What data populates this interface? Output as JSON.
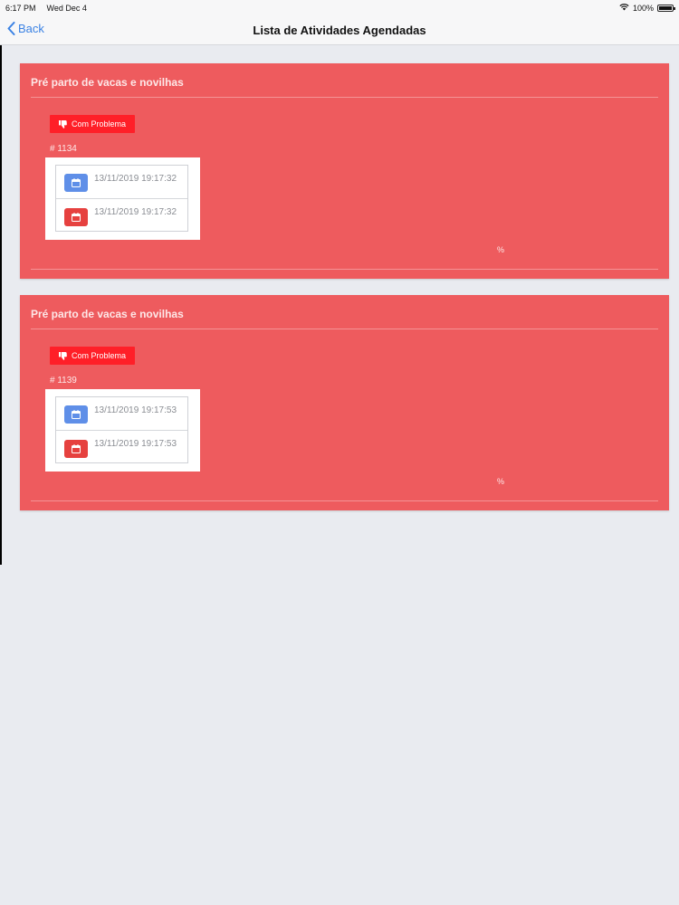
{
  "status_bar": {
    "time": "6:17 PM",
    "date": "Wed Dec 4",
    "battery": "100%"
  },
  "nav": {
    "back_label": "Back",
    "title": "Lista de Atividades Agendadas"
  },
  "cards": [
    {
      "title": "Pré parto de vacas e novilhas",
      "status": "Com Problema",
      "id": "# 1134",
      "date_start": "13/11/2019 19:17:32",
      "date_end": "13/11/2019 19:17:32",
      "percent": "%"
    },
    {
      "title": "Pré parto de vacas e novilhas",
      "status": "Com Problema",
      "id": "# 1139",
      "date_start": "13/11/2019 19:17:53",
      "date_end": "13/11/2019 19:17:53",
      "percent": "%"
    }
  ],
  "colors": {
    "card_bg": "#ee5b5e",
    "badge_bg": "#ff1f28",
    "start_icon": "#5f8fe8",
    "end_icon": "#e6413f",
    "accent": "#3b82e4"
  }
}
